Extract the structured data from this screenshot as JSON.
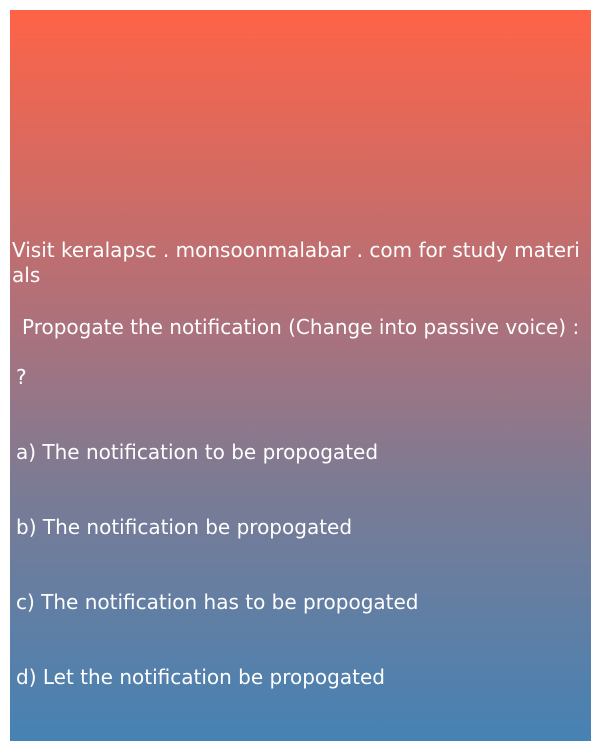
{
  "promo_text": "Visit keralapsc . monsoonmalabar . com for study materials",
  "question": {
    "text": "Propogate the notification (Change into passive voice) :",
    "mark": "?"
  },
  "options": [
    "a) The notification to be propogated",
    "b) The notification be propogated",
    "c) The notification has to be propogated",
    "d) Let the notification be propogated"
  ],
  "colors": {
    "gradient_top": "#ff6347",
    "gradient_bottom": "#4682b4",
    "text": "#ffffff"
  }
}
